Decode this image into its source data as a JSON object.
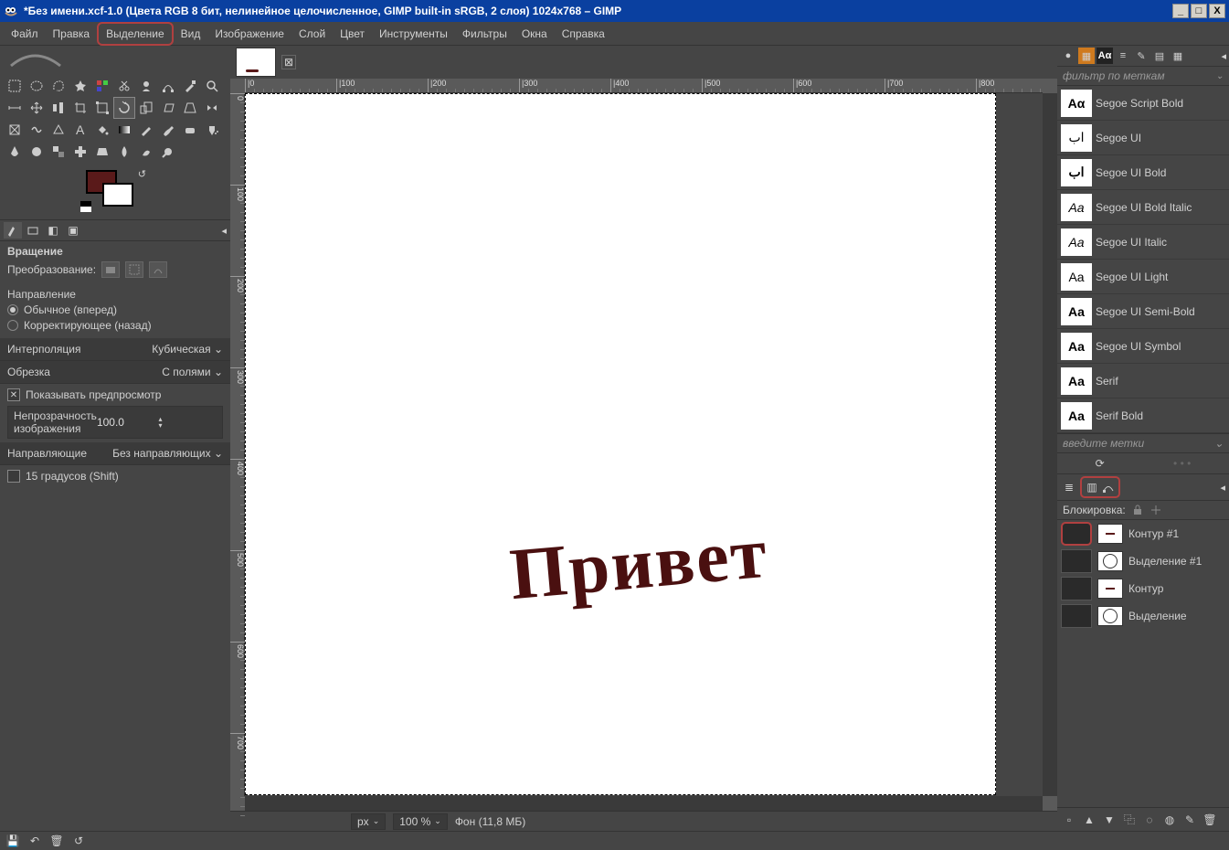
{
  "titlebar": {
    "text": "*Без имени.xcf-1.0 (Цвета RGB 8 бит, нелинейное целочисленное, GIMP built-in sRGB, 2 слоя) 1024x768 – GIMP"
  },
  "menu": {
    "items": [
      "Файл",
      "Правка",
      "Выделение",
      "Вид",
      "Изображение",
      "Слой",
      "Цвет",
      "Инструменты",
      "Фильтры",
      "Окна",
      "Справка"
    ],
    "highlighted_index": 2
  },
  "tool_options": {
    "title": "Вращение",
    "transform_label": "Преобразование:",
    "direction_label": "Направление",
    "direction_normal": "Обычное (вперед)",
    "direction_corrective": "Корректирующее (назад)",
    "interp_label": "Интерполяция",
    "interp_value": "Кубическая",
    "clip_label": "Обрезка",
    "clip_value": "С полями",
    "preview_label": "Показывать предпросмотр",
    "opacity_label": "Непрозрачность изображения",
    "opacity_value": "100.0",
    "guides_label": "Направляющие",
    "guides_value": "Без направляющих",
    "fifteen_label": "15 градусов (Shift)"
  },
  "ruler": {
    "h_ticks": [
      "0",
      "100",
      "200",
      "300",
      "400",
      "500",
      "600",
      "700",
      "800"
    ],
    "v_ticks": [
      "0",
      "100",
      "200",
      "300",
      "400",
      "500",
      "600",
      "700"
    ]
  },
  "canvas": {
    "text": "Привет"
  },
  "status": {
    "unit": "px",
    "zoom": "100 %",
    "layer": "Фон (11,8 МБ)"
  },
  "fonts": {
    "filter_placeholder": "фильтр по меткам",
    "tags_placeholder": "введите метки",
    "items": [
      {
        "name": "Segoe Script Bold",
        "preview": "Aα",
        "style": ""
      },
      {
        "name": "Segoe UI",
        "preview": "اب",
        "style": "light"
      },
      {
        "name": "Segoe UI Bold",
        "preview": "اب",
        "style": ""
      },
      {
        "name": "Segoe UI Bold Italic",
        "preview": "Aa",
        "style": "it"
      },
      {
        "name": "Segoe UI Italic",
        "preview": "Aa",
        "style": "it"
      },
      {
        "name": "Segoe UI Light",
        "preview": "Aa",
        "style": "light"
      },
      {
        "name": "Segoe UI Semi-Bold",
        "preview": "Aa",
        "style": ""
      },
      {
        "name": "Segoe UI Symbol",
        "preview": "Aa",
        "style": ""
      },
      {
        "name": "Serif",
        "preview": "Aa",
        "style": ""
      },
      {
        "name": "Serif Bold",
        "preview": "Aa",
        "style": ""
      }
    ]
  },
  "paths": {
    "lock_label": "Блокировка:",
    "items": [
      {
        "name": "Контур #1",
        "thumb": "sq"
      },
      {
        "name": "Выделение #1",
        "thumb": "circ"
      },
      {
        "name": "Контур",
        "thumb": "sq"
      },
      {
        "name": "Выделение",
        "thumb": "circ"
      }
    ]
  }
}
